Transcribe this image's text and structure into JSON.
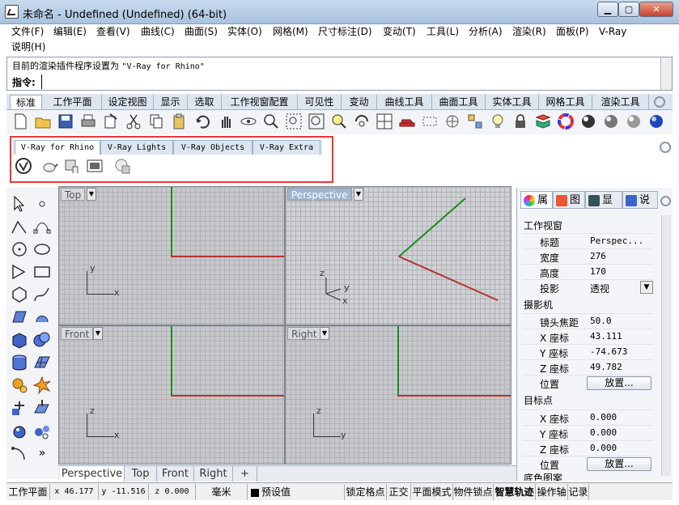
{
  "window": {
    "title": "未命名 - Undefined (Undefined) (64-bit)",
    "min": "▁",
    "max": "▢",
    "close": "✕"
  },
  "menu": {
    "row1": [
      "文件(F)",
      "编辑(E)",
      "查看(V)",
      "曲线(C)",
      "曲面(S)",
      "实体(O)",
      "网格(M)",
      "尺寸标注(D)",
      "变动(T)",
      "工具(L)",
      "分析(A)",
      "渲染(R)",
      "面板(P)",
      "V-Ray"
    ],
    "row2": [
      "说明(H)"
    ]
  },
  "command": {
    "history_prefix": "目前的渲染插件程序设置为",
    "history_value": "\"V-Ray for Rhino\"",
    "prompt": "指令:",
    "input_value": ""
  },
  "tabs": [
    "标准",
    "工作平面",
    "设定视图",
    "显示",
    "选取",
    "工作视窗配置",
    "可见性",
    "变动",
    "曲线工具",
    "曲面工具",
    "实体工具",
    "网格工具",
    "渲染工具"
  ],
  "toolbar_icons": [
    "new-file",
    "open-folder",
    "save",
    "print",
    "import",
    "cut",
    "copy",
    "paste",
    "undo",
    "pan-hand",
    "rotate-view",
    "zoom",
    "zoom-window",
    "zoom-extents",
    "zoom-selected",
    "rotate-camera",
    "four-viewports",
    "car",
    "select-box",
    "point-snap",
    "lightbulb",
    "lock",
    "layer-book",
    "color-wheel",
    "render-sphere",
    "material-sphere",
    "grey-sphere",
    "blue-sphere"
  ],
  "vray": {
    "tabs": [
      "V-Ray for Rhino",
      "V-Ray Lights",
      "V-Ray Objects",
      "V-Ray Extra"
    ],
    "icons": [
      "vray-logo",
      "teapot",
      "render-hand",
      "frame-buffer",
      "vray-batch"
    ]
  },
  "viewports": {
    "top": {
      "label": "Top",
      "axis_v": "y",
      "axis_h": "x"
    },
    "perspective": {
      "label": "Perspective",
      "axis_v": "z",
      "axis_h": "x",
      "axis_d": "y"
    },
    "front": {
      "label": "Front",
      "axis_v": "z",
      "axis_h": "x"
    },
    "right": {
      "label": "Right",
      "axis_v": "z",
      "axis_h": "y"
    }
  },
  "viewport_tabs": [
    "Perspective",
    "Top",
    "Front",
    "Right"
  ],
  "viewport_tabs_add": "+",
  "panel": {
    "tabs": [
      "属",
      "图",
      "显",
      "说"
    ],
    "section_viewport": "工作视窗",
    "title_label": "标题",
    "title_value": "Perspec...",
    "width_label": "宽度",
    "width_value": "276",
    "height_label": "高度",
    "height_value": "170",
    "projection_label": "投影",
    "projection_value": "透视",
    "section_camera": "摄影机",
    "focal_label": "镜头焦距",
    "focal_value": "50.0",
    "cam_x_label": "X 座标",
    "cam_x": "43.111",
    "cam_y_label": "Y 座标",
    "cam_y": "-74.673",
    "cam_z_label": "Z 座标",
    "cam_z": "49.782",
    "position_label": "位置",
    "place_button": "放置...",
    "section_target": "目标点",
    "tgt_x_label": "X 座标",
    "tgt_x": "0.000",
    "tgt_y_label": "Y 座标",
    "tgt_y": "0.000",
    "tgt_z_label": "Z 座标",
    "tgt_z": "0.000",
    "tgt_position_label": "位置",
    "tgt_place_button": "放置...",
    "section_bottom": "底色图案"
  },
  "status": {
    "cplane": "工作平面",
    "x": "x 46.177",
    "y": "y -11.516",
    "z": "z 0.000",
    "units": "毫米",
    "layer": "预设值",
    "grid_snap": "锁定格点",
    "ortho": "正交",
    "planar": "平面模式",
    "osnap": "物件锁点",
    "smart_track": "智慧轨迹",
    "gumball": "操作轴",
    "record": "记录"
  },
  "colors": {
    "accent_tab": "#9eb5d4",
    "highlight_border": "#e53935",
    "x_axis": "#b33333",
    "y_axis": "#1c8c1c"
  }
}
